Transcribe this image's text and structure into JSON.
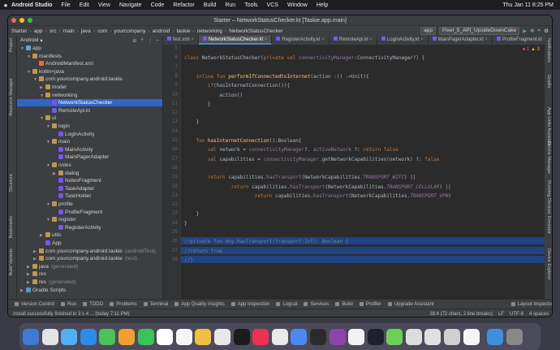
{
  "menubar": {
    "app": "Android Studio",
    "items": [
      "File",
      "Edit",
      "View",
      "Navigate",
      "Code",
      "Refactor",
      "Build",
      "Run",
      "Tools",
      "VCS",
      "Window",
      "Help"
    ],
    "clock": "Thu Jan 11  8:25 PM"
  },
  "window": {
    "title": "Starter – NetworkStatusChecker.kt [Taskie.app.main]"
  },
  "nav": {
    "crumbs": [
      "Starter",
      "app",
      "src",
      "main",
      "java",
      "com",
      "yourcompany",
      "android",
      "taskie",
      "networking",
      "NetworkStatusChecker"
    ],
    "config": "app",
    "device": "Pixel_5_API_UpsideDownCake"
  },
  "project": {
    "header": "Android",
    "rows": [
      {
        "label": "app",
        "level": 0,
        "type": "fold-b",
        "open": true
      },
      {
        "label": "manifests",
        "level": 1,
        "type": "fold",
        "open": true
      },
      {
        "label": "AndroidManifest.xml",
        "level": 2,
        "type": "xml",
        "open": null
      },
      {
        "label": "kotlin+java",
        "level": 1,
        "type": "fold",
        "open": true
      },
      {
        "label": "com.yourcompany.android.taskie",
        "level": 2,
        "type": "fold",
        "open": true
      },
      {
        "label": "model",
        "level": 3,
        "type": "fold",
        "open": false
      },
      {
        "label": "networking",
        "level": 3,
        "type": "fold",
        "open": true
      },
      {
        "label": "NetworkStatusChecker",
        "level": 4,
        "type": "kt",
        "open": null,
        "selected": true
      },
      {
        "label": "RemoteApi.kt",
        "level": 4,
        "type": "kt",
        "open": null
      },
      {
        "label": "ui",
        "level": 3,
        "type": "fold",
        "open": true
      },
      {
        "label": "login",
        "level": 4,
        "type": "fold",
        "open": true
      },
      {
        "label": "LoginActivity",
        "level": 5,
        "type": "kt",
        "open": null
      },
      {
        "label": "main",
        "level": 4,
        "type": "fold",
        "open": true
      },
      {
        "label": "MainActivity",
        "level": 5,
        "type": "kt",
        "open": null
      },
      {
        "label": "MainPagerAdapter",
        "level": 5,
        "type": "kt",
        "open": null
      },
      {
        "label": "notes",
        "level": 4,
        "type": "fold",
        "open": true
      },
      {
        "label": "dialog",
        "level": 5,
        "type": "fold",
        "open": false
      },
      {
        "label": "NotesFragment",
        "level": 5,
        "type": "kt",
        "open": null
      },
      {
        "label": "TaskAdapter",
        "level": 5,
        "type": "kt",
        "open": null
      },
      {
        "label": "TaskHolder",
        "level": 5,
        "type": "kt",
        "open": null
      },
      {
        "label": "profile",
        "level": 4,
        "type": "fold",
        "open": true
      },
      {
        "label": "ProfileFragment",
        "level": 5,
        "type": "kt",
        "open": null
      },
      {
        "label": "register",
        "level": 4,
        "type": "fold",
        "open": true
      },
      {
        "label": "RegisterActivity",
        "level": 5,
        "type": "kt",
        "open": null
      },
      {
        "label": "utils",
        "level": 3,
        "type": "fold",
        "open": false
      },
      {
        "label": "App",
        "level": 3,
        "type": "kt",
        "open": null
      },
      {
        "label": "com.yourcompany.android.taskie",
        "extra": "(androidTest)",
        "level": 2,
        "type": "fold",
        "open": false
      },
      {
        "label": "com.yourcompany.android.taskie",
        "extra": "(test)",
        "level": 2,
        "type": "fold",
        "open": false
      },
      {
        "label": "java",
        "extra": "(generated)",
        "level": 1,
        "type": "fold",
        "open": false
      },
      {
        "label": "res",
        "level": 1,
        "type": "fold",
        "open": false
      },
      {
        "label": "res",
        "extra": "(generated)",
        "level": 1,
        "type": "fold",
        "open": false
      },
      {
        "label": "Gradle Scripts",
        "level": 0,
        "type": "gr",
        "open": false
      }
    ]
  },
  "tabs": [
    {
      "label": "fest.xml",
      "active": false
    },
    {
      "label": "NetworkStatusChecker.kt",
      "active": true
    },
    {
      "label": "RegisterActivity.kt",
      "active": false
    },
    {
      "label": "RemoteApi.kt",
      "active": false
    },
    {
      "label": "LoginActivity.kt",
      "active": false
    },
    {
      "label": "MainPagerAdapter.kt",
      "active": false
    },
    {
      "label": "ProfileFragment.kt",
      "active": false
    }
  ],
  "editor": {
    "warnings": "3",
    "errors": "1",
    "lines": [
      {
        "n": "5",
        "s": []
      },
      {
        "n": "6",
        "s": [
          {
            "k": "kw",
            "t": "class "
          },
          {
            "k": "",
            "t": "NetworkStatusChecker("
          },
          {
            "k": "kw",
            "t": "private val "
          },
          {
            "k": "pr",
            "t": "connectivityManager"
          },
          {
            "k": "",
            "t": ":ConnectivityManager?) {"
          }
        ]
      },
      {
        "n": "7",
        "s": []
      },
      {
        "n": "8",
        "s": [
          {
            "k": "",
            "t": "    "
          },
          {
            "k": "kw",
            "t": "inline fun "
          },
          {
            "k": "fn",
            "t": "performIfConnectedtoInternet"
          },
          {
            "k": "",
            "t": "(action :() ->Unit){"
          }
        ]
      },
      {
        "n": "9",
        "s": [
          {
            "k": "",
            "t": "        "
          },
          {
            "k": "kw",
            "t": "if"
          },
          {
            "k": "",
            "t": "(hasInternetConnection()){"
          }
        ]
      },
      {
        "n": "10",
        "s": [
          {
            "k": "",
            "t": "            action()"
          }
        ]
      },
      {
        "n": "11",
        "s": [
          {
            "k": "",
            "t": "        }"
          }
        ]
      },
      {
        "n": "12",
        "s": []
      },
      {
        "n": "13",
        "s": [
          {
            "k": "",
            "t": "    }"
          }
        ]
      },
      {
        "n": "14",
        "s": []
      },
      {
        "n": "15",
        "s": [
          {
            "k": "",
            "t": "    "
          },
          {
            "k": "kw",
            "t": "fun "
          },
          {
            "k": "fn",
            "t": "hasInternetConnection"
          },
          {
            "k": "",
            "t": "():Boolean{"
          }
        ]
      },
      {
        "n": "16",
        "s": [
          {
            "k": "",
            "t": "        "
          },
          {
            "k": "kw",
            "t": "val "
          },
          {
            "k": "",
            "t": "network = "
          },
          {
            "k": "pr",
            "t": "connectivityManager"
          },
          {
            "k": "",
            "t": "?. "
          },
          {
            "k": "pr",
            "t": "activeNetwork"
          },
          {
            "k": "",
            "t": " ?: "
          },
          {
            "k": "kw",
            "t": "return false"
          }
        ]
      },
      {
        "n": "17",
        "s": [
          {
            "k": "",
            "t": "        "
          },
          {
            "k": "kw",
            "t": "val "
          },
          {
            "k": "",
            "t": "capabilities = "
          },
          {
            "k": "pr",
            "t": "connectivityManager"
          },
          {
            "k": "",
            "t": ".getNetworkCapabilities(network) ?: "
          },
          {
            "k": "kw",
            "t": "false"
          }
        ]
      },
      {
        "n": "18",
        "s": []
      },
      {
        "n": "19",
        "s": [
          {
            "k": "",
            "t": "        "
          },
          {
            "k": "kw",
            "t": "return "
          },
          {
            "k": "",
            "t": "capabilities."
          },
          {
            "k": "pr",
            "t": "hasTransport"
          },
          {
            "k": "",
            "t": "(NetworkCapabilities."
          },
          {
            "k": "it",
            "t": "TRANSPORT_WIFI"
          },
          {
            "k": "",
            "t": ") ||"
          }
        ]
      },
      {
        "n": "20",
        "s": [
          {
            "k": "",
            "t": "                "
          },
          {
            "k": "kw",
            "t": "return "
          },
          {
            "k": "",
            "t": "capabilities."
          },
          {
            "k": "pr",
            "t": "hasTransport"
          },
          {
            "k": "",
            "t": "(NetworkCapabilities."
          },
          {
            "k": "it",
            "t": "TRANSPORT_CELLULAR"
          },
          {
            "k": "",
            "t": ") ||"
          }
        ]
      },
      {
        "n": "21",
        "s": [
          {
            "k": "",
            "t": "                        "
          },
          {
            "k": "kw",
            "t": "return "
          },
          {
            "k": "",
            "t": "capabilities."
          },
          {
            "k": "pr",
            "t": "hasTransport"
          },
          {
            "k": "",
            "t": "(NetworkCapabilities."
          },
          {
            "k": "it",
            "t": "TRANSPORT_VPN"
          },
          {
            "k": "",
            "t": ")"
          }
        ]
      },
      {
        "n": "22",
        "s": []
      },
      {
        "n": "23",
        "s": [
          {
            "k": "",
            "t": "    }"
          }
        ]
      },
      {
        "n": "24",
        "s": [
          {
            "k": "",
            "t": "}"
          }
        ]
      },
      {
        "n": "25",
        "s": []
      },
      {
        "n": "26",
        "s": [
          {
            "k": "cm",
            "t": "//private fun Any.hasTransport(transport:Int): Boolean {"
          }
        ],
        "hl": true
      },
      {
        "n": "27",
        "s": [
          {
            "k": "cm",
            "t": "//return true"
          }
        ],
        "hl": true
      },
      {
        "n": "28",
        "s": [
          {
            "k": "cm",
            "t": "//}"
          }
        ],
        "hl": true
      }
    ]
  },
  "left_tools": [
    "Project",
    "Resource Manager",
    "Structure",
    "Bookmarks",
    "Build Variants"
  ],
  "right_tools": [
    "Notifications",
    "Gradle",
    "App Links Assistant",
    "Device Manager",
    "Running Devices",
    "Emulator",
    "Device Explorer"
  ],
  "bottom_tools": [
    "Version Control",
    "Run",
    "TODO",
    "Problems",
    "Terminal",
    "App Quality Insights",
    "App Inspection",
    "Logcat",
    "Services",
    "Build",
    "Profiler",
    "Upgrade Assistant",
    "Layout Inspector"
  ],
  "status": {
    "message": "Install successfully finished in 3 s 4 ... (today 7:11 PM)",
    "position": "28:4 (72 chars, 2 line breaks)",
    "line_sep": "LF",
    "encoding": "UTF-8",
    "indent": "4 spaces"
  },
  "dock_colors": [
    "#3d7bd6",
    "#e3e3e3",
    "#4fb0f5",
    "#2f8be8",
    "#4dc15a",
    "#f0a030",
    "#39c35b",
    "#ffffff",
    "#f5f5f5",
    "#f0c040",
    "#e8e8e8",
    "#1b1b1b",
    "#f03050",
    "#e8e8e8",
    "#4a8af0",
    "#2b2b2b",
    "#8e44ad",
    "#f2f2f2",
    "#1f1f2e",
    "#6ad05a",
    "#dcdcdc",
    "#e0e0e0",
    "#cfcfcf",
    "#f5f5f5",
    "#3d8fe0",
    "#888888"
  ]
}
